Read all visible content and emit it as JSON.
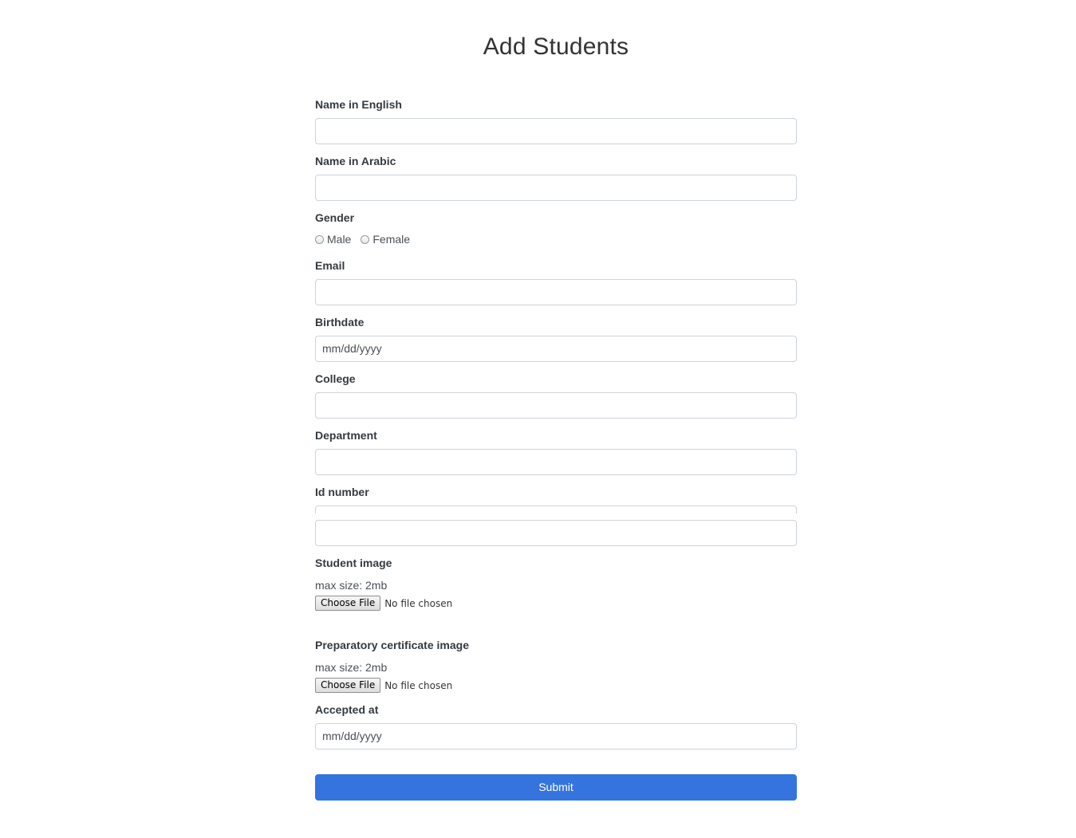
{
  "page": {
    "title": "Add Students"
  },
  "form": {
    "name_en": {
      "label": "Name in English",
      "value": ""
    },
    "name_ar": {
      "label": "Name in Arabic",
      "value": ""
    },
    "gender": {
      "label": "Gender",
      "options": [
        "Male",
        "Female"
      ]
    },
    "email": {
      "label": "Email",
      "value": ""
    },
    "birthdate": {
      "label": "Birthdate",
      "placeholder": "mm/dd/yyyy"
    },
    "college": {
      "label": "College",
      "value": ""
    },
    "department": {
      "label": "Department",
      "value": ""
    },
    "id_number": {
      "label": "Id number",
      "value": ""
    },
    "student_image": {
      "label": "Student image",
      "hint": "max size: 2mb",
      "button": "Choose File",
      "status": "No file chosen"
    },
    "prep_cert_image": {
      "label": "Preparatory certificate image",
      "hint": "max size: 2mb",
      "button": "Choose File",
      "status": "No file chosen"
    },
    "accepted_at": {
      "label": "Accepted at",
      "placeholder": "mm/dd/yyyy"
    },
    "submit_label": "Submit"
  },
  "colors": {
    "submit_bg": "#3574df",
    "border": "#ced4da",
    "label": "#343a40"
  }
}
